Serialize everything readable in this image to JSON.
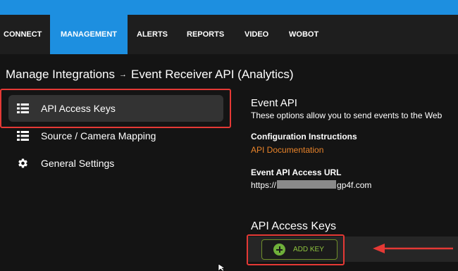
{
  "nav": {
    "items": [
      {
        "label": "CONNECT",
        "active": false
      },
      {
        "label": "MANAGEMENT",
        "active": true
      },
      {
        "label": "ALERTS",
        "active": false
      },
      {
        "label": "REPORTS",
        "active": false
      },
      {
        "label": "VIDEO",
        "active": false
      },
      {
        "label": "WOBOT",
        "active": false
      }
    ]
  },
  "breadcrumb": {
    "root": "Manage Integrations",
    "separator": "→",
    "current": "Event Receiver API (Analytics)"
  },
  "sidebar": {
    "items": [
      {
        "label": "API Access Keys",
        "icon": "list-icon",
        "active": true
      },
      {
        "label": "Source / Camera Mapping",
        "icon": "list-icon",
        "active": false
      },
      {
        "label": "General Settings",
        "icon": "gear-icon",
        "active": false
      }
    ]
  },
  "main": {
    "title": "Event API",
    "description": "These options allow you to send events to the Web",
    "config_label": "Configuration Instructions",
    "doc_link": "API Documentation",
    "url_label": "Event API Access URL",
    "url_prefix": "https://",
    "url_suffix": "gp4f.com",
    "keys_title": "API Access Keys",
    "add_key_label": "ADD KEY"
  },
  "colors": {
    "accent": "#1d8fe0",
    "highlight": "#e53935",
    "link": "#e8832a",
    "add_key": "#8fc43e"
  }
}
